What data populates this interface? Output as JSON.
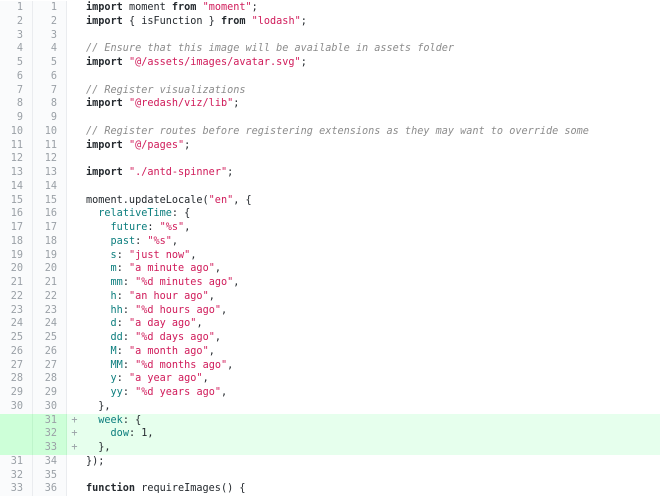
{
  "lines": [
    {
      "old": "1",
      "new": "1",
      "marker": "",
      "type": "ctx",
      "tokens": [
        [
          "k",
          "import"
        ],
        [
          "plain",
          " moment "
        ],
        [
          "k",
          "from"
        ],
        [
          "plain",
          " "
        ],
        [
          "s",
          "\"moment\""
        ],
        [
          "plain",
          ";"
        ]
      ]
    },
    {
      "old": "2",
      "new": "2",
      "marker": "",
      "type": "ctx",
      "tokens": [
        [
          "k",
          "import"
        ],
        [
          "plain",
          " { isFunction } "
        ],
        [
          "k",
          "from"
        ],
        [
          "plain",
          " "
        ],
        [
          "s",
          "\"lodash\""
        ],
        [
          "plain",
          ";"
        ]
      ]
    },
    {
      "old": "3",
      "new": "3",
      "marker": "",
      "type": "ctx",
      "tokens": []
    },
    {
      "old": "4",
      "new": "4",
      "marker": "",
      "type": "ctx",
      "tokens": [
        [
          "c",
          "// Ensure that this image will be available in assets folder"
        ]
      ]
    },
    {
      "old": "5",
      "new": "5",
      "marker": "",
      "type": "ctx",
      "tokens": [
        [
          "k",
          "import"
        ],
        [
          "plain",
          " "
        ],
        [
          "s",
          "\"@/assets/images/avatar.svg\""
        ],
        [
          "plain",
          ";"
        ]
      ]
    },
    {
      "old": "6",
      "new": "6",
      "marker": "",
      "type": "ctx",
      "tokens": []
    },
    {
      "old": "7",
      "new": "7",
      "marker": "",
      "type": "ctx",
      "tokens": [
        [
          "c",
          "// Register visualizations"
        ]
      ]
    },
    {
      "old": "8",
      "new": "8",
      "marker": "",
      "type": "ctx",
      "tokens": [
        [
          "k",
          "import"
        ],
        [
          "plain",
          " "
        ],
        [
          "s",
          "\"@redash/viz/lib\""
        ],
        [
          "plain",
          ";"
        ]
      ]
    },
    {
      "old": "9",
      "new": "9",
      "marker": "",
      "type": "ctx",
      "tokens": []
    },
    {
      "old": "10",
      "new": "10",
      "marker": "",
      "type": "ctx",
      "tokens": [
        [
          "c",
          "// Register routes before registering extensions as they may want to override some"
        ]
      ]
    },
    {
      "old": "11",
      "new": "11",
      "marker": "",
      "type": "ctx",
      "tokens": [
        [
          "k",
          "import"
        ],
        [
          "plain",
          " "
        ],
        [
          "s",
          "\"@/pages\""
        ],
        [
          "plain",
          ";"
        ]
      ]
    },
    {
      "old": "12",
      "new": "12",
      "marker": "",
      "type": "ctx",
      "tokens": []
    },
    {
      "old": "13",
      "new": "13",
      "marker": "",
      "type": "ctx",
      "tokens": [
        [
          "k",
          "import"
        ],
        [
          "plain",
          " "
        ],
        [
          "s",
          "\"./antd-spinner\""
        ],
        [
          "plain",
          ";"
        ]
      ]
    },
    {
      "old": "14",
      "new": "14",
      "marker": "",
      "type": "ctx",
      "tokens": []
    },
    {
      "old": "15",
      "new": "15",
      "marker": "",
      "type": "ctx",
      "tokens": [
        [
          "plain",
          "moment.updateLocale("
        ],
        [
          "s",
          "\"en\""
        ],
        [
          "plain",
          ", {"
        ]
      ]
    },
    {
      "old": "16",
      "new": "16",
      "marker": "",
      "type": "ctx",
      "tokens": [
        [
          "plain",
          "  "
        ],
        [
          "p",
          "relativeTime"
        ],
        [
          "plain",
          ": {"
        ]
      ]
    },
    {
      "old": "17",
      "new": "17",
      "marker": "",
      "type": "ctx",
      "tokens": [
        [
          "plain",
          "    "
        ],
        [
          "p",
          "future"
        ],
        [
          "plain",
          ": "
        ],
        [
          "s",
          "\"%s\""
        ],
        [
          "plain",
          ","
        ]
      ]
    },
    {
      "old": "18",
      "new": "18",
      "marker": "",
      "type": "ctx",
      "tokens": [
        [
          "plain",
          "    "
        ],
        [
          "p",
          "past"
        ],
        [
          "plain",
          ": "
        ],
        [
          "s",
          "\"%s\""
        ],
        [
          "plain",
          ","
        ]
      ]
    },
    {
      "old": "19",
      "new": "19",
      "marker": "",
      "type": "ctx",
      "tokens": [
        [
          "plain",
          "    "
        ],
        [
          "p",
          "s"
        ],
        [
          "plain",
          ": "
        ],
        [
          "s",
          "\"just now\""
        ],
        [
          "plain",
          ","
        ]
      ]
    },
    {
      "old": "20",
      "new": "20",
      "marker": "",
      "type": "ctx",
      "tokens": [
        [
          "plain",
          "    "
        ],
        [
          "p",
          "m"
        ],
        [
          "plain",
          ": "
        ],
        [
          "s",
          "\"a minute ago\""
        ],
        [
          "plain",
          ","
        ]
      ]
    },
    {
      "old": "21",
      "new": "21",
      "marker": "",
      "type": "ctx",
      "tokens": [
        [
          "plain",
          "    "
        ],
        [
          "p",
          "mm"
        ],
        [
          "plain",
          ": "
        ],
        [
          "s",
          "\"%d minutes ago\""
        ],
        [
          "plain",
          ","
        ]
      ]
    },
    {
      "old": "22",
      "new": "22",
      "marker": "",
      "type": "ctx",
      "tokens": [
        [
          "plain",
          "    "
        ],
        [
          "p",
          "h"
        ],
        [
          "plain",
          ": "
        ],
        [
          "s",
          "\"an hour ago\""
        ],
        [
          "plain",
          ","
        ]
      ]
    },
    {
      "old": "23",
      "new": "23",
      "marker": "",
      "type": "ctx",
      "tokens": [
        [
          "plain",
          "    "
        ],
        [
          "p",
          "hh"
        ],
        [
          "plain",
          ": "
        ],
        [
          "s",
          "\"%d hours ago\""
        ],
        [
          "plain",
          ","
        ]
      ]
    },
    {
      "old": "24",
      "new": "24",
      "marker": "",
      "type": "ctx",
      "tokens": [
        [
          "plain",
          "    "
        ],
        [
          "p",
          "d"
        ],
        [
          "plain",
          ": "
        ],
        [
          "s",
          "\"a day ago\""
        ],
        [
          "plain",
          ","
        ]
      ]
    },
    {
      "old": "25",
      "new": "25",
      "marker": "",
      "type": "ctx",
      "tokens": [
        [
          "plain",
          "    "
        ],
        [
          "p",
          "dd"
        ],
        [
          "plain",
          ": "
        ],
        [
          "s",
          "\"%d days ago\""
        ],
        [
          "plain",
          ","
        ]
      ]
    },
    {
      "old": "26",
      "new": "26",
      "marker": "",
      "type": "ctx",
      "tokens": [
        [
          "plain",
          "    "
        ],
        [
          "p",
          "M"
        ],
        [
          "plain",
          ": "
        ],
        [
          "s",
          "\"a month ago\""
        ],
        [
          "plain",
          ","
        ]
      ]
    },
    {
      "old": "27",
      "new": "27",
      "marker": "",
      "type": "ctx",
      "tokens": [
        [
          "plain",
          "    "
        ],
        [
          "p",
          "MM"
        ],
        [
          "plain",
          ": "
        ],
        [
          "s",
          "\"%d months ago\""
        ],
        [
          "plain",
          ","
        ]
      ]
    },
    {
      "old": "28",
      "new": "28",
      "marker": "",
      "type": "ctx",
      "tokens": [
        [
          "plain",
          "    "
        ],
        [
          "p",
          "y"
        ],
        [
          "plain",
          ": "
        ],
        [
          "s",
          "\"a year ago\""
        ],
        [
          "plain",
          ","
        ]
      ]
    },
    {
      "old": "29",
      "new": "29",
      "marker": "",
      "type": "ctx",
      "tokens": [
        [
          "plain",
          "    "
        ],
        [
          "p",
          "yy"
        ],
        [
          "plain",
          ": "
        ],
        [
          "s",
          "\"%d years ago\""
        ],
        [
          "plain",
          ","
        ]
      ]
    },
    {
      "old": "30",
      "new": "30",
      "marker": "",
      "type": "ctx",
      "tokens": [
        [
          "plain",
          "  },"
        ]
      ]
    },
    {
      "old": "",
      "new": "31",
      "marker": "+",
      "type": "add",
      "tokens": [
        [
          "plain",
          "  "
        ],
        [
          "p",
          "week"
        ],
        [
          "plain",
          ": {"
        ]
      ]
    },
    {
      "old": "",
      "new": "32",
      "marker": "+",
      "type": "add",
      "tokens": [
        [
          "plain",
          "    "
        ],
        [
          "p",
          "dow"
        ],
        [
          "plain",
          ": 1,"
        ]
      ]
    },
    {
      "old": "",
      "new": "33",
      "marker": "+",
      "type": "add",
      "tokens": [
        [
          "plain",
          "  },"
        ]
      ]
    },
    {
      "old": "31",
      "new": "34",
      "marker": "",
      "type": "ctx",
      "tokens": [
        [
          "plain",
          "});"
        ]
      ]
    },
    {
      "old": "32",
      "new": "35",
      "marker": "",
      "type": "ctx",
      "tokens": []
    },
    {
      "old": "33",
      "new": "36",
      "marker": "",
      "type": "ctx",
      "tokens": [
        [
          "k",
          "function"
        ],
        [
          "plain",
          " requireImages() {"
        ]
      ]
    }
  ]
}
